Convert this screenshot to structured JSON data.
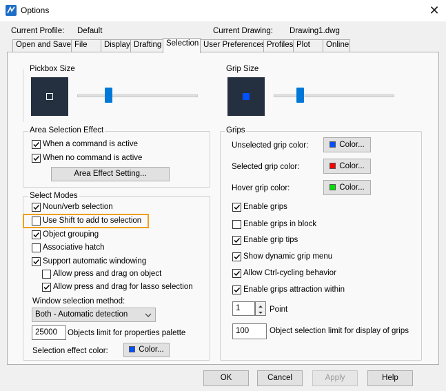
{
  "window": {
    "title": "Options",
    "close_glyph": "✕"
  },
  "info": {
    "profile_label": "Current Profile:",
    "profile_value": "Default",
    "drawing_label": "Current Drawing:",
    "drawing_value": "Drawing1.dwg"
  },
  "tabs": [
    {
      "label": "Open and Save"
    },
    {
      "label": "File"
    },
    {
      "label": "Display"
    },
    {
      "label": "Drafting"
    },
    {
      "label": "Selection",
      "active": true
    },
    {
      "label": "User Preferences"
    },
    {
      "label": "Profiles"
    },
    {
      "label": "Plot"
    },
    {
      "label": "Online"
    }
  ],
  "pickbox": {
    "label": "Pickbox Size"
  },
  "grip_size": {
    "label": "Grip Size"
  },
  "area_selection": {
    "label": "Area Selection Effect",
    "when_active": "When a command is active",
    "when_not_active": "When no command is active",
    "effect_button": "Area Effect Setting..."
  },
  "select_modes": {
    "label": "Select Modes",
    "noun_verb": "Noun/verb selection",
    "use_shift": "Use Shift to add to selection",
    "object_grouping": "Object grouping",
    "assoc_hatch": "Associative hatch",
    "auto_window": "Support automatic windowing",
    "press_drag": "Allow press and drag on object",
    "press_drag_lasso": "Allow press and drag for lasso selection",
    "window_method_label": "Window selection method:",
    "window_method_value": "Both - Automatic detection",
    "obj_limit_value": "25000",
    "obj_limit_label": "Objects limit for properties palette",
    "effect_color_label": "Selection effect color:",
    "effect_color_button": "Color..."
  },
  "grips": {
    "label": "Grips",
    "unselected_label": "Unselected grip color:",
    "selected_label": "Selected grip color:",
    "hover_label": "Hover grip color:",
    "color_button": "Color...",
    "enable_grips": "Enable grips",
    "grips_in_block": "Enable grips in block",
    "grip_tips": "Enable grip tips",
    "dynamic_menu": "Show dynamic grip menu",
    "ctrl_cycling": "Allow Ctrl-cycling behavior",
    "attraction": "Enable grips attraction within",
    "point_value": "1",
    "point_label": "Point",
    "limit_value": "100",
    "limit_label": "Object selection limit for display of grips"
  },
  "buttons": {
    "ok": "OK",
    "cancel": "Cancel",
    "apply": "Apply",
    "help": "Help"
  },
  "colors": {
    "accent": "#0078d7",
    "highlight": "#f0a01c",
    "blue_grip": "#0050ff",
    "red_grip": "#ff0000",
    "green_grip": "#00e000",
    "preview_bg": "#243040"
  }
}
